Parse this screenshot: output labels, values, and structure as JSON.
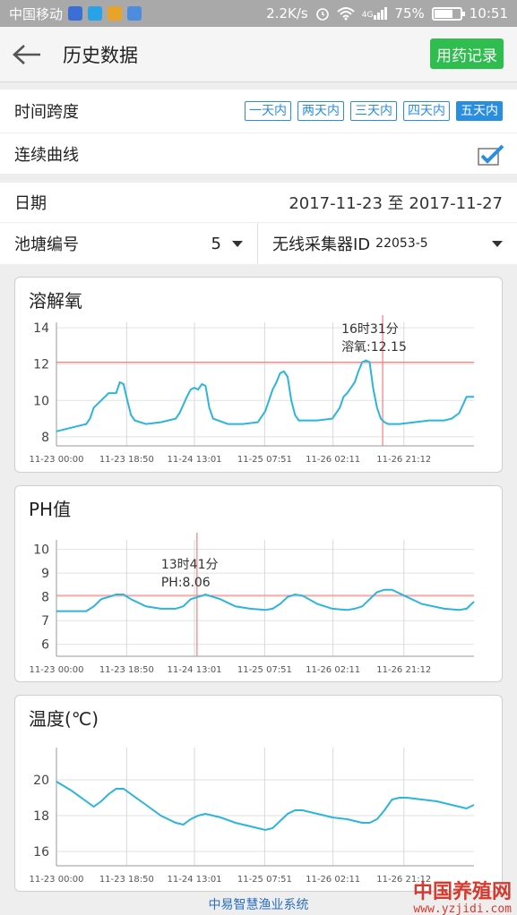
{
  "status_bar": {
    "carrier": "中国移动",
    "net_speed": "2.2K/s",
    "network": "4G",
    "battery": "75%",
    "battery_level": 0.75,
    "time": "10:51"
  },
  "header": {
    "title": "历史数据",
    "action_label": "用药记录"
  },
  "filters": {
    "span_label": "时间跨度",
    "span_options": [
      "一天内",
      "两天内",
      "三天内",
      "四天内",
      "五天内"
    ],
    "span_selected": "五天内",
    "continuous_label": "连续曲线",
    "continuous_checked": true,
    "date_label": "日期",
    "date_value": "2017-11-23 至 2017-11-27",
    "pond_label": "池塘编号",
    "pond_value": "5",
    "collector_label": "无线采集器ID",
    "collector_value": "22053-5"
  },
  "colors": {
    "accent": "#2a8ee0",
    "action_green": "#2fbd4f",
    "line": "#2cb5dc",
    "marker": "#f08080"
  },
  "chart_data": [
    {
      "type": "line",
      "title": "溶解氧",
      "ylim": [
        7.5,
        14.3
      ],
      "yticks": [
        8,
        10,
        12,
        14
      ],
      "x_tick_labels": [
        "11-23 00:00",
        "11-23 18:50",
        "11-24 13:01",
        "11-25 07:51",
        "11-26 02:11",
        "11-26 21:12"
      ],
      "x_tick_hours": [
        0,
        18.83,
        37.02,
        55.85,
        74.18,
        93.2
      ],
      "x_range_hours": [
        0,
        112
      ],
      "reference_y": 12.1,
      "marker_hour": 87.5,
      "tooltip": {
        "time": "16时31分",
        "label": "溶氧:12.15"
      },
      "series": [
        {
          "x": [
            0,
            4,
            8,
            9,
            10,
            12,
            14,
            16,
            17,
            18,
            19,
            20,
            21,
            24,
            28,
            32,
            33,
            35,
            36,
            37,
            38,
            39,
            40,
            41,
            42,
            46,
            50,
            54,
            56,
            58,
            59,
            60,
            61,
            62,
            63,
            64,
            65,
            66,
            70,
            74,
            76,
            77,
            78,
            79,
            80,
            81,
            82,
            83,
            84,
            85,
            86,
            87,
            88,
            89,
            90,
            91,
            92,
            96,
            100,
            104,
            106,
            108,
            110,
            112
          ],
          "y": [
            8.3,
            8.5,
            8.7,
            9.0,
            9.6,
            10.0,
            10.4,
            10.4,
            11.0,
            10.9,
            10.0,
            9.2,
            8.9,
            8.7,
            8.8,
            9.0,
            9.3,
            10.2,
            10.6,
            10.7,
            10.6,
            10.9,
            10.8,
            9.6,
            9.0,
            8.7,
            8.7,
            8.8,
            9.4,
            10.6,
            11.0,
            11.5,
            11.6,
            11.3,
            10.0,
            9.2,
            8.9,
            8.9,
            8.9,
            9.0,
            9.6,
            10.2,
            10.4,
            10.7,
            11.0,
            11.6,
            12.1,
            12.2,
            12.1,
            10.6,
            9.6,
            9.0,
            8.8,
            8.7,
            8.7,
            8.7,
            8.7,
            8.8,
            8.9,
            8.9,
            9.0,
            9.3,
            10.2,
            10.2
          ]
        }
      ]
    },
    {
      "type": "line",
      "title": "PH值",
      "ylim": [
        5.5,
        10.4
      ],
      "yticks": [
        6,
        7,
        8,
        9,
        10
      ],
      "x_tick_labels": [
        "11-23 00:00",
        "11-23 18:50",
        "11-24 13:01",
        "11-25 07:51",
        "11-26 02:11",
        "11-26 21:12"
      ],
      "x_tick_hours": [
        0,
        18.83,
        37.02,
        55.85,
        74.18,
        93.2
      ],
      "x_range_hours": [
        0,
        112
      ],
      "reference_y": 8.06,
      "marker_hour": 37.7,
      "tooltip": {
        "time": "13时41分",
        "label": "PH:8.06"
      },
      "series": [
        {
          "x": [
            0,
            4,
            8,
            10,
            12,
            14,
            16,
            18,
            20,
            24,
            28,
            32,
            34,
            36,
            38,
            40,
            44,
            48,
            52,
            56,
            58,
            60,
            62,
            64,
            66,
            70,
            74,
            78,
            80,
            82,
            84,
            86,
            88,
            90,
            94,
            98,
            104,
            108,
            110,
            112
          ],
          "y": [
            7.4,
            7.4,
            7.4,
            7.6,
            7.9,
            8.0,
            8.1,
            8.1,
            7.9,
            7.6,
            7.5,
            7.5,
            7.6,
            7.9,
            8.0,
            8.1,
            7.9,
            7.6,
            7.5,
            7.45,
            7.5,
            7.7,
            8.0,
            8.1,
            8.05,
            7.7,
            7.5,
            7.45,
            7.5,
            7.6,
            7.9,
            8.2,
            8.3,
            8.3,
            8.0,
            7.7,
            7.5,
            7.45,
            7.5,
            7.8
          ]
        }
      ]
    },
    {
      "type": "line",
      "title": "温度(℃)",
      "ylim": [
        15.2,
        21.8
      ],
      "yticks": [
        16,
        18,
        20
      ],
      "x_tick_labels": [
        "11-23 00:00",
        "11-23 18:50",
        "11-24 13:01",
        "11-25 07:51",
        "11-26 02:11",
        "11-26 21:12"
      ],
      "x_tick_hours": [
        0,
        18.83,
        37.02,
        55.85,
        74.18,
        93.2
      ],
      "x_range_hours": [
        0,
        112
      ],
      "series": [
        {
          "x": [
            0,
            4,
            8,
            10,
            12,
            14,
            16,
            18,
            20,
            24,
            28,
            32,
            34,
            36,
            38,
            40,
            44,
            48,
            52,
            56,
            58,
            60,
            62,
            64,
            66,
            70,
            74,
            78,
            80,
            82,
            84,
            86,
            88,
            90,
            92,
            94,
            98,
            102,
            106,
            110,
            112
          ],
          "y": [
            19.9,
            19.4,
            18.8,
            18.5,
            18.8,
            19.2,
            19.5,
            19.5,
            19.2,
            18.6,
            18.0,
            17.6,
            17.5,
            17.8,
            18.0,
            18.1,
            17.9,
            17.6,
            17.4,
            17.2,
            17.3,
            17.7,
            18.1,
            18.3,
            18.3,
            18.1,
            17.9,
            17.8,
            17.7,
            17.6,
            17.6,
            17.8,
            18.3,
            18.9,
            19.0,
            19.0,
            18.9,
            18.8,
            18.6,
            18.4,
            18.6
          ]
        }
      ]
    }
  ],
  "footer": {
    "text": "中易智慧渔业系统"
  },
  "watermark": {
    "text": "中国养殖网",
    "url": "www.yzjidi.com"
  }
}
